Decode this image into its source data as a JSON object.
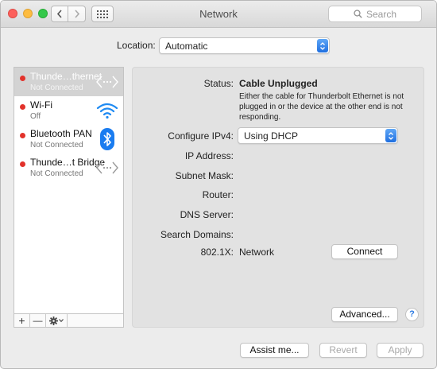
{
  "window": {
    "title": "Network"
  },
  "search": {
    "placeholder": "Search"
  },
  "location": {
    "label": "Location:",
    "value": "Automatic"
  },
  "services": [
    {
      "name": "Thunde…thernet",
      "status": "Not Connected",
      "icon": "ethernet-arrows-icon",
      "selected": true
    },
    {
      "name": "Wi-Fi",
      "status": "Off",
      "icon": "wifi-icon",
      "selected": false
    },
    {
      "name": "Bluetooth PAN",
      "status": "Not Connected",
      "icon": "bluetooth-icon",
      "selected": false
    },
    {
      "name": "Thunde…t Bridge",
      "status": "Not Connected",
      "icon": "ethernet-arrows-icon",
      "selected": false
    }
  ],
  "sidebar_buttons": {
    "add": "+",
    "remove": "—"
  },
  "detail": {
    "status_label": "Status:",
    "status_value": "Cable Unplugged",
    "status_description": "Either the cable for Thunderbolt Ethernet is not plugged in or the device at the other end is not responding.",
    "configure_label": "Configure IPv4:",
    "configure_value": "Using DHCP",
    "ip_label": "IP Address:",
    "subnet_label": "Subnet Mask:",
    "router_label": "Router:",
    "dns_label": "DNS Server:",
    "search_domains_label": "Search Domains:",
    "dot1x_label": "802.1X:",
    "dot1x_value": "Network",
    "connect_button": "Connect",
    "advanced_button": "Advanced...",
    "help_button": "?"
  },
  "footer": {
    "assist_button": "Assist me...",
    "revert_button": "Revert",
    "apply_button": "Apply"
  },
  "colors": {
    "accent": "#1f6fe0",
    "status_red": "#e2322b",
    "bluetooth": "#1a7cf0",
    "wifi": "#1f8af2"
  }
}
